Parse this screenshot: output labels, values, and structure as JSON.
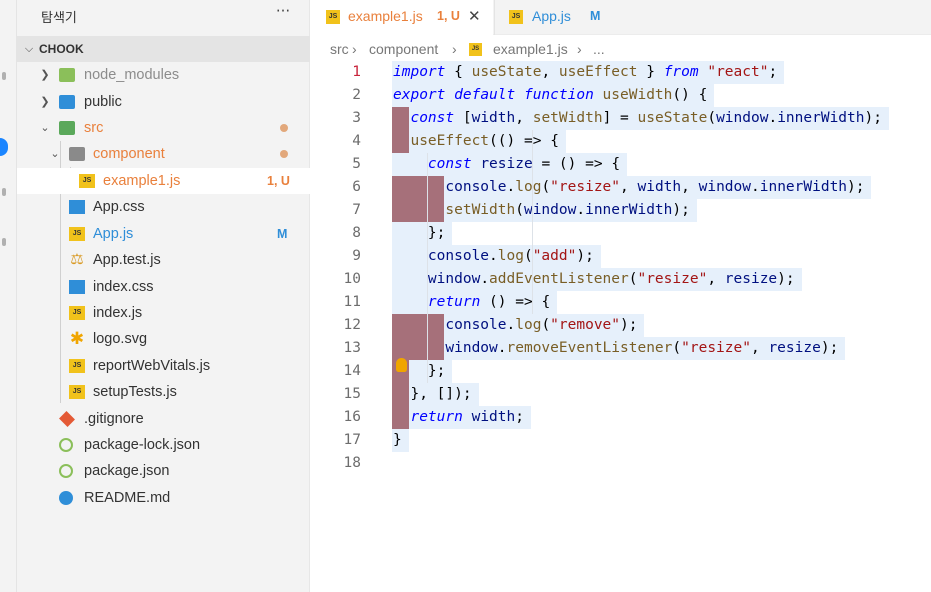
{
  "sidebar": {
    "title": "탐색기",
    "more": "···",
    "section": "CHOOK",
    "items": [
      {
        "name": "node_modules",
        "kind": "folder",
        "color": "#8bbf5a",
        "dim": true
      },
      {
        "name": "public",
        "kind": "folder",
        "color": "#2f8ed8"
      },
      {
        "name": "src",
        "kind": "folder",
        "color": "#5aa85a",
        "status": "modified-dot"
      },
      {
        "name": "component",
        "kind": "folder",
        "color": "#8a8a8a",
        "status": "modified-dot"
      },
      {
        "name": "example1.js",
        "kind": "js",
        "badge": "1, U"
      },
      {
        "name": "App.css",
        "kind": "css"
      },
      {
        "name": "App.js",
        "kind": "js",
        "badge": "M"
      },
      {
        "name": "App.test.js",
        "kind": "test"
      },
      {
        "name": "index.css",
        "kind": "css"
      },
      {
        "name": "index.js",
        "kind": "js"
      },
      {
        "name": "logo.svg",
        "kind": "svg"
      },
      {
        "name": "reportWebVitals.js",
        "kind": "js"
      },
      {
        "name": "setupTests.js",
        "kind": "js"
      },
      {
        "name": ".gitignore",
        "kind": "git"
      },
      {
        "name": "package-lock.json",
        "kind": "json"
      },
      {
        "name": "package.json",
        "kind": "json"
      },
      {
        "name": "README.md",
        "kind": "info"
      }
    ]
  },
  "tabs": [
    {
      "label": "example1.js",
      "badge": "1, U",
      "active": true,
      "close": "✕"
    },
    {
      "label": "App.js",
      "badge": "M",
      "active": false
    }
  ],
  "breadcrumb": [
    "src",
    "component",
    "example1.js",
    "..."
  ],
  "editor": {
    "current_line": 1,
    "lines": [
      "import { useState, useEffect } from \"react\";",
      "export default function useWidth() {",
      "  const [width, setWidth] = useState(window.innerWidth);",
      "  useEffect(() => {",
      "    const resize = () => {",
      "      console.log(\"resize\", width, window.innerWidth);",
      "      setWidth(window.innerWidth);",
      "    };",
      "    console.log(\"add\");",
      "    window.addEventListener(\"resize\", resize);",
      "    return () => {",
      "      console.log(\"remove\");",
      "      window.removeEventListener(\"resize\", resize);",
      "    };",
      "  }, []);",
      "  return width;",
      "}",
      ""
    ]
  },
  "colors": {
    "accent": "#1a85ff",
    "untracked": "#e9803c",
    "modified": "#2f8ed8",
    "keyword": "#0000ff",
    "string": "#a31515",
    "function": "#795e26",
    "variable": "#001080"
  }
}
